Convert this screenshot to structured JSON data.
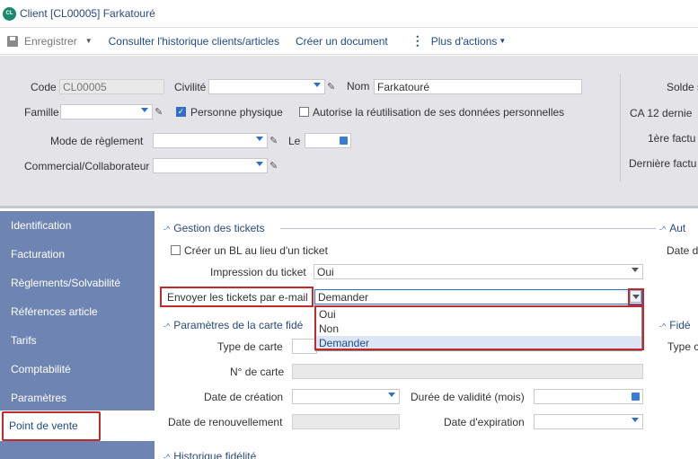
{
  "window": {
    "badge": "CL",
    "title": "Client [CL00005] Farkatouré"
  },
  "toolbar": {
    "save_label": "Enregistrer",
    "history_label": "Consulter l'historique clients/articles",
    "create_doc_label": "Créer un document",
    "more_label": "Plus d'actions"
  },
  "header": {
    "code_label": "Code",
    "code_value": "CL00005",
    "civilite_label": "Civilité",
    "civilite_value": "",
    "nom_label": "Nom",
    "nom_value": "Farkatouré",
    "famille_label": "Famille",
    "famille_value": "",
    "personne_physique_label": "Personne physique",
    "personne_physique_checked": true,
    "autorise_label": "Autorise la réutilisation de ses données personnelles",
    "autorise_checked": false,
    "mode_reglement_label": "Mode de règlement",
    "le_label": "Le",
    "commercial_label": "Commercial/Collaborateur",
    "right_labels": [
      "Solde s",
      "CA 12 dernie",
      "1ère factu",
      "Dernière factu"
    ]
  },
  "sidebar": {
    "items": [
      {
        "label": "Identification"
      },
      {
        "label": "Facturation"
      },
      {
        "label": "Règlements/Solvabilité"
      },
      {
        "label": "Références article"
      },
      {
        "label": "Tarifs"
      },
      {
        "label": "Comptabilité"
      },
      {
        "label": "Paramètres"
      },
      {
        "label": "Point de vente"
      }
    ],
    "active_index": 7
  },
  "tickets": {
    "section_title": "Gestion des tickets",
    "bl_label": "Créer un BL au lieu d'un ticket",
    "bl_checked": false,
    "impression_label": "Impression du ticket",
    "impression_value": "Oui",
    "envoyer_label": "Envoyer les tickets par e-mail",
    "envoyer_value": "Demander",
    "options": [
      "Oui",
      "Non",
      "Demander"
    ],
    "selected_option": "Demander"
  },
  "fidelite": {
    "section_title": "Paramètres de la carte fidé",
    "type_label": "Type de carte",
    "numero_label": "N° de carte",
    "date_creation_label": "Date de création",
    "duree_label": "Durée de validité (mois)",
    "date_renouvellement_label": "Date de renouvellement",
    "date_expiration_label": "Date d'expiration"
  },
  "right_panel": {
    "auto_title": "Aut",
    "date_label": "Date d",
    "fide_title": "Fidé",
    "type_label": "Type c"
  },
  "historique": {
    "section_title": "Historique fidélité"
  }
}
